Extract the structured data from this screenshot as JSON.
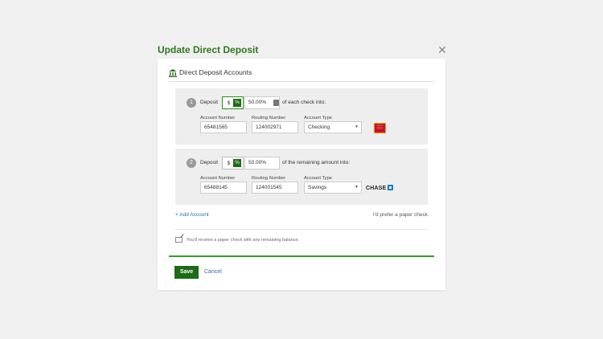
{
  "dialog": {
    "title": "Update Direct Deposit",
    "close_icon": "close-icon"
  },
  "section": {
    "icon": "bank-icon",
    "title": "Direct Deposit Accounts"
  },
  "accounts": [
    {
      "number": "1",
      "deposit_label": "Deposit",
      "dollar_symbol": "$",
      "percent_symbol": "%",
      "amount": "50.00%",
      "suffix": "of each check into:",
      "account_number_label": "Account Number",
      "account_number": "65481565",
      "routing_number_label": "Routing Number",
      "routing_number": "124002971",
      "account_type_label": "Account Type",
      "account_type": "Checking",
      "bank_logo": "wells-fargo-logo",
      "bank_logo_text": "WELLS FARGO"
    },
    {
      "number": "2",
      "deposit_label": "Deposit",
      "dollar_symbol": "$",
      "percent_symbol": "%",
      "amount": "50.00%",
      "suffix": "of the remaining amount into:",
      "account_number_label": "Account Number",
      "account_number": "65488145",
      "routing_number_label": "Routing Number",
      "routing_number": "124001545",
      "account_type_label": "Account Type",
      "account_type": "Savings",
      "bank_logo": "chase-logo",
      "bank_logo_text": "CHASE"
    }
  ],
  "links": {
    "add_account": "+ Add Account",
    "paper_check": "I'd prefer a paper check"
  },
  "note": "You'll receive a paper check with any remaining balance.",
  "buttons": {
    "save": "Save",
    "cancel": "Cancel"
  },
  "colors": {
    "brand_green": "#1d6b14",
    "title_green": "#2d7a1e",
    "link_blue": "#2a6db5"
  }
}
